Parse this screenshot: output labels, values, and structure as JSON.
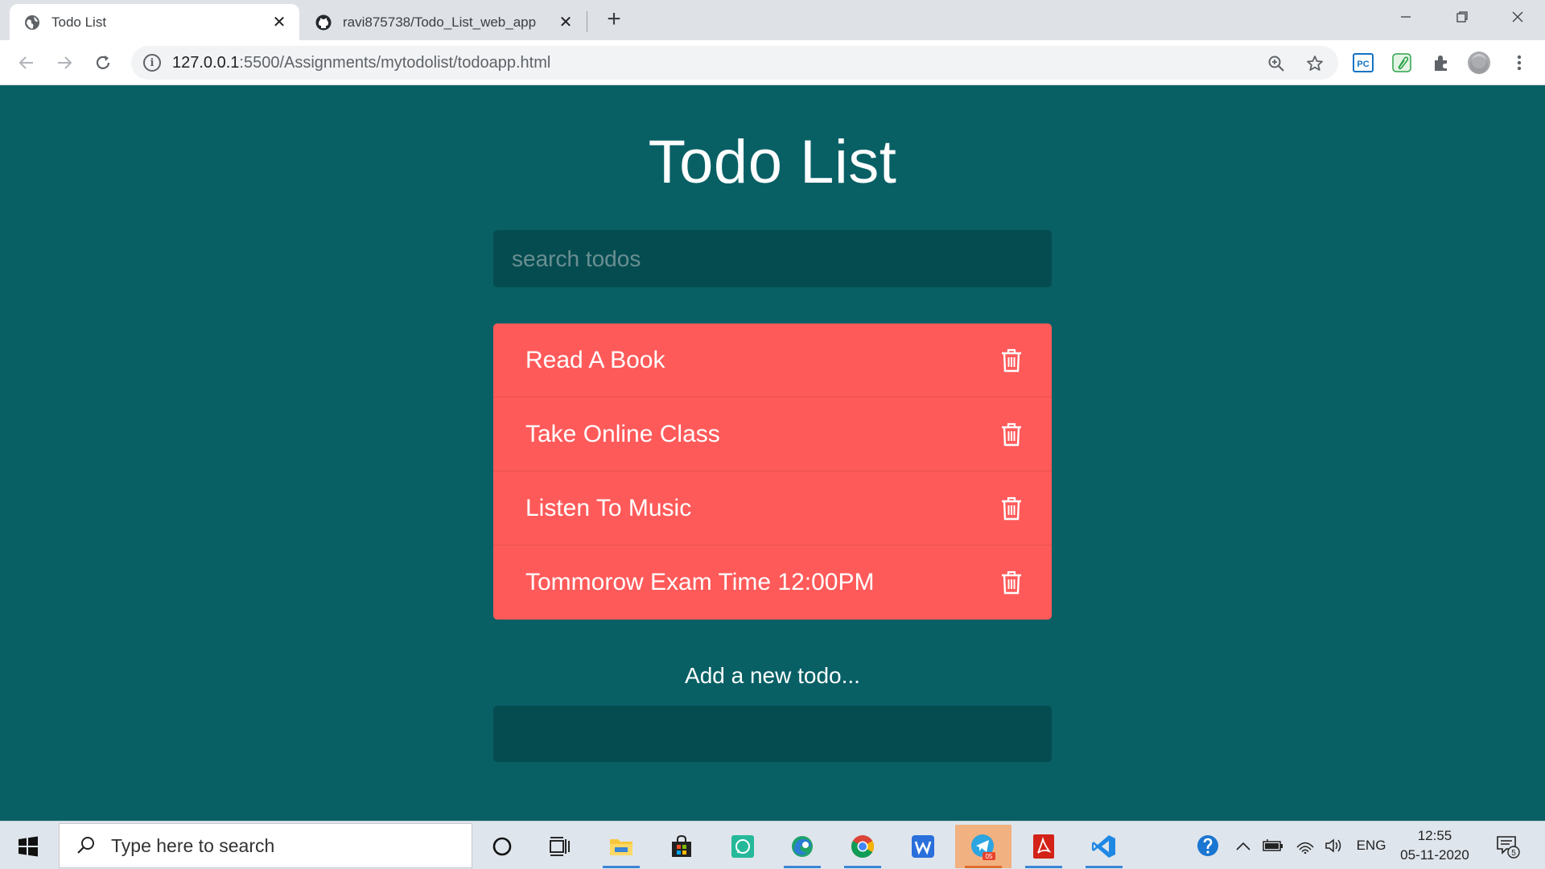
{
  "browser": {
    "tabs": [
      {
        "title": "Todo List",
        "icon": "globe-icon",
        "active": true
      },
      {
        "title": "ravi875738/Todo_List_web_app",
        "icon": "github-icon",
        "active": false
      }
    ],
    "new_tab_label": "+",
    "url_host": "127.0.0.1",
    "url_path": ":5500/Assignments/mytodolist/todoapp.html",
    "ext_pc_label": "PC"
  },
  "app": {
    "title": "Todo List",
    "search_placeholder": "search todos",
    "todos": [
      {
        "text": "Read A Book"
      },
      {
        "text": "Take Online Class"
      },
      {
        "text": "Listen To Music"
      },
      {
        "text": "Tommorow Exam Time 12:00PM"
      }
    ],
    "add_label": "Add a new todo...",
    "add_value": "",
    "colors": {
      "background": "#086065",
      "input_background": "#054c51",
      "todo_background": "#ff5a5a"
    }
  },
  "taskbar": {
    "search_placeholder": "Type here to search",
    "telegram_badge": "05",
    "language": "ENG",
    "time": "12:55",
    "date": "05-11-2020",
    "notification_count": "5"
  }
}
